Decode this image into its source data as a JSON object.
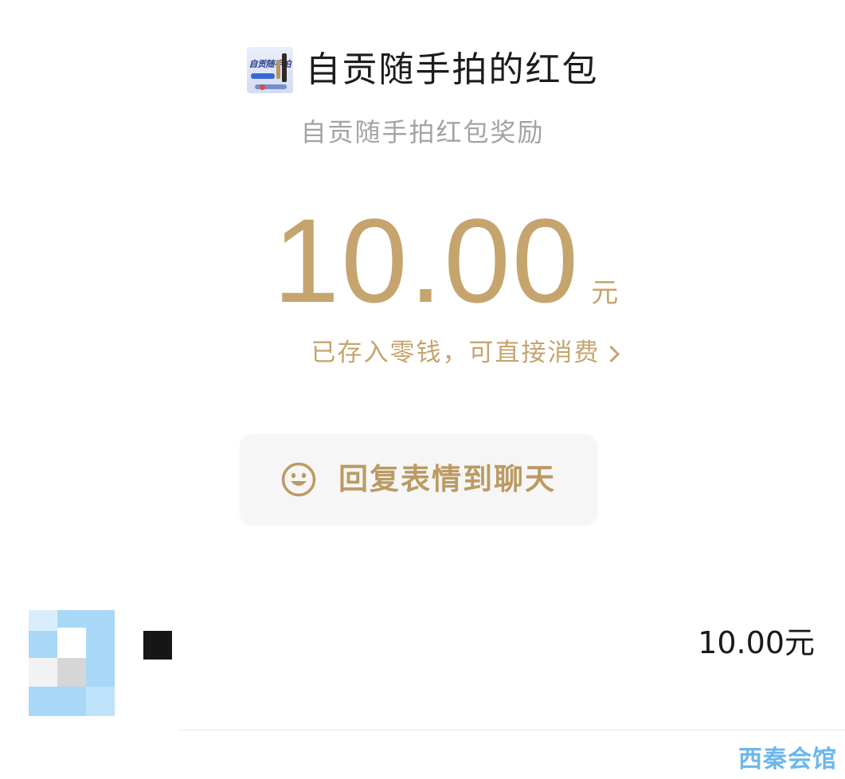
{
  "header": {
    "sender_icon_text": "自贡随手拍",
    "title": "自贡随手拍的红包",
    "subtitle": "自贡随手拍红包奖励"
  },
  "amount": {
    "value": "10.00",
    "unit": "元"
  },
  "deposit": {
    "label": "已存入零钱，可直接消费"
  },
  "reply": {
    "label": "回复表情到聊天"
  },
  "receivers": [
    {
      "amount": "10.00元"
    }
  ],
  "watermark": {
    "text": "西秦会馆"
  },
  "colors": {
    "accent_gold": "#c5a46e",
    "title": "#1c1c1c",
    "subtitle": "#a3a3a3",
    "button_bg": "#f6f6f6",
    "watermark": "#5cb0ea"
  }
}
